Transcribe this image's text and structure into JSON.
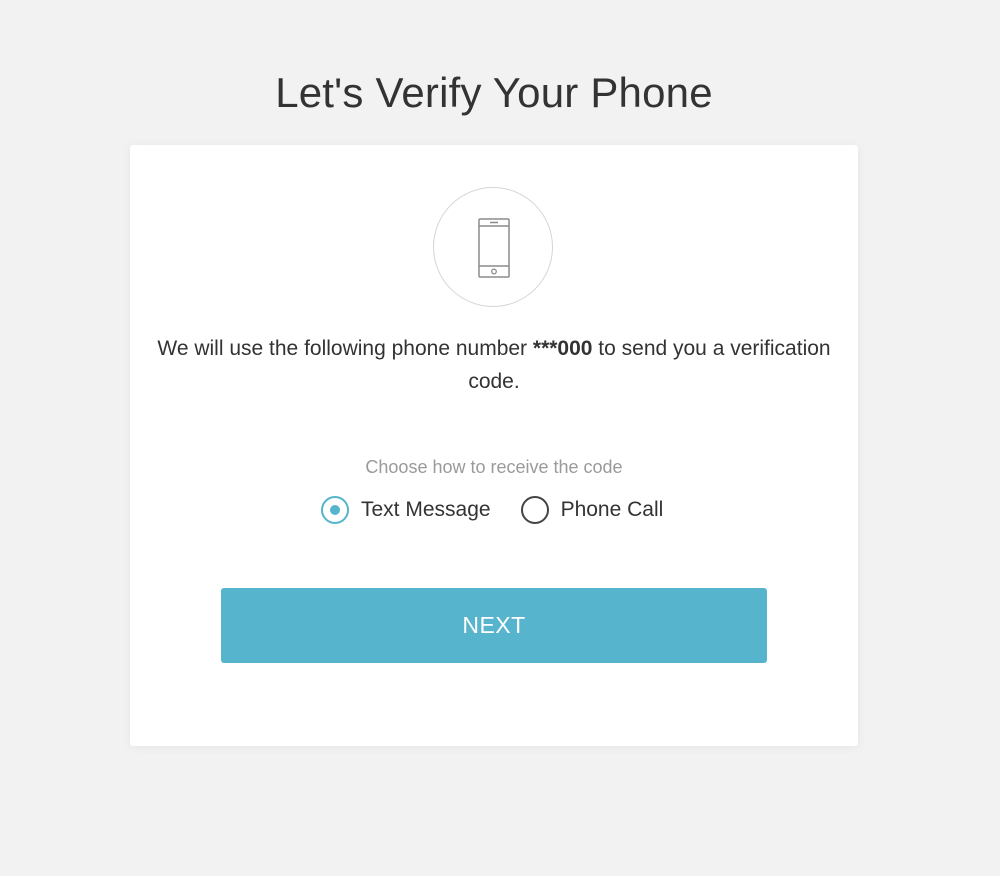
{
  "page": {
    "title": "Let's Verify Your Phone"
  },
  "card": {
    "icon": "smartphone-icon",
    "message_before": "We will use the following phone number ",
    "phone_number": "***000",
    "message_after": " to send you a verification code.",
    "choose_label": "Choose how to receive the code",
    "options": [
      {
        "label": "Text Message",
        "selected": true
      },
      {
        "label": "Phone Call",
        "selected": false
      }
    ],
    "next_label": "NEXT"
  },
  "colors": {
    "accent": "#57b4cd",
    "background": "#f2f2f2",
    "card": "#ffffff",
    "text": "#333333",
    "muted": "#9a9a9a"
  }
}
